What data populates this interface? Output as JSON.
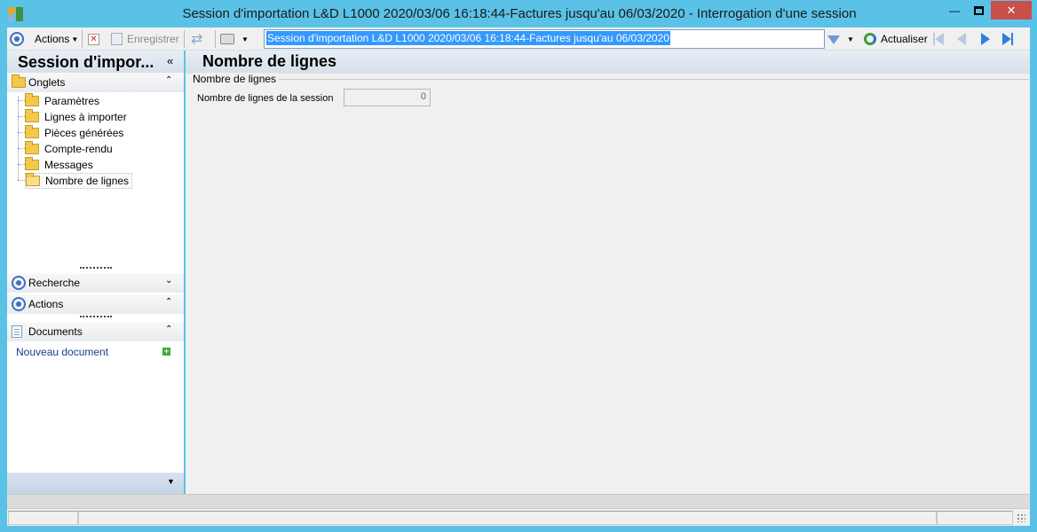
{
  "window": {
    "title": "Session d'importation L&D L1000 2020/03/06 16:18:44-Factures jusqu'au 06/03/2020 -  Interrogation d'une session",
    "minimize_glyph": "—",
    "maximize_glyph": "□",
    "close_glyph": "✕"
  },
  "toolbar": {
    "actions_label": "Actions",
    "save_label": "Enregistrer",
    "search_value": "Session d'importation L&D L1000 2020/03/06 16:18:44-Factures jusqu'au 06/03/2020",
    "refresh_label": "Actualiser"
  },
  "left_panel": {
    "title": "Session d'impor...",
    "collapse_glyph": "«",
    "sections": {
      "onglets": {
        "label": "Onglets",
        "arrow": "⌃"
      },
      "recherche": {
        "label": "Recherche",
        "arrow": "⌄"
      },
      "actions": {
        "label": "Actions",
        "arrow": "⌃"
      },
      "documents": {
        "label": "Documents",
        "arrow": "⌃"
      }
    },
    "tabs": [
      {
        "label": "Paramètres"
      },
      {
        "label": "Lignes à importer"
      },
      {
        "label": "Pièces générées"
      },
      {
        "label": "Compte-rendu"
      },
      {
        "label": "Messages"
      },
      {
        "label": "Nombre de lignes"
      }
    ],
    "selected_tab_index": 5,
    "new_document_label": "Nouveau document",
    "bottom_arrow": "▼"
  },
  "main": {
    "title": "Nombre de lignes",
    "group_title": "Nombre de lignes",
    "field_label": "Nombre de lignes de la session",
    "field_value": "0"
  },
  "colors": {
    "frame": "#5bc2e7",
    "close_button": "#c7504b",
    "selection": "#3399ff",
    "header_gradient_top": "#e8eef5",
    "link": "#1c3c8c"
  }
}
